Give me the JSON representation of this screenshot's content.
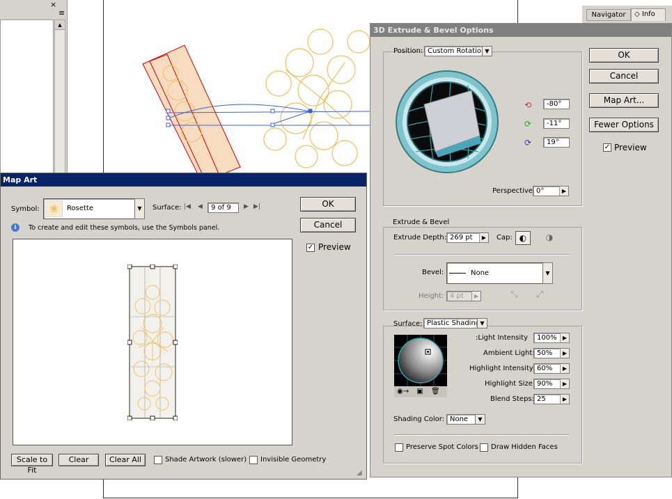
{
  "layers_panel": {
    "close": "×",
    "menu": "≡"
  },
  "right_panel": {
    "tabs": [
      "Navigator",
      "Info"
    ]
  },
  "map_art": {
    "title": "Map Art",
    "symbol_label": "Symbol:",
    "symbol_value": "Rosette",
    "surface_label": "Surface:",
    "surface_value": "9 of 9",
    "info_text": "To create and edit these symbols, use the Symbols panel.",
    "ok": "OK",
    "cancel": "Cancel",
    "preview_label": "Preview",
    "preview_checked": true,
    "scale_to_fit": "Scale to Fit",
    "clear": "Clear",
    "clear_all": "Clear All",
    "shade_artwork": "Shade Artwork (slower)",
    "invisible_geometry": "Invisible Geometry"
  },
  "extrude": {
    "title": "3D Extrude & Bevel Options",
    "position_label": "Position:",
    "position_value": "Custom Rotation",
    "rot_x": "-80°",
    "rot_y": "-11°",
    "rot_z": "19°",
    "perspective_label": "Perspective:",
    "perspective_value": "0°",
    "ok": "OK",
    "cancel": "Cancel",
    "map_art": "Map Art...",
    "fewer_options": "Fewer Options",
    "preview_label": "Preview",
    "preview_checked": true,
    "extrude_section": "Extrude & Bevel",
    "extrude_depth_label": "Extrude Depth:",
    "extrude_depth_value": "269 pt",
    "cap_label": "Cap:",
    "bevel_label": "Bevel:",
    "bevel_value": "None",
    "height_label": "Height:",
    "height_value": "4 pt",
    "surface_label": "Surface:",
    "surface_value": "Plastic Shading",
    "light_intensity_label": "Light Intensity:",
    "light_intensity_value": "100%",
    "ambient_light_label": "Ambient Light:",
    "ambient_light_value": "50%",
    "highlight_intensity_label": "Highlight Intensity:",
    "highlight_intensity_value": "60%",
    "highlight_size_label": "Highlight Size:",
    "highlight_size_value": "90%",
    "blend_steps_label": "Blend Steps:",
    "blend_steps_value": "25",
    "shading_color_label": "Shading Color:",
    "shading_color_value": "None",
    "preserve_spot": "Preserve Spot Colors",
    "draw_hidden": "Draw Hidden Faces"
  },
  "colors": {
    "dialog_bg": "#d6d3cc",
    "title_bar": "#0a246a",
    "title_bar_inactive": "#808080",
    "flower": "#f0c060"
  }
}
